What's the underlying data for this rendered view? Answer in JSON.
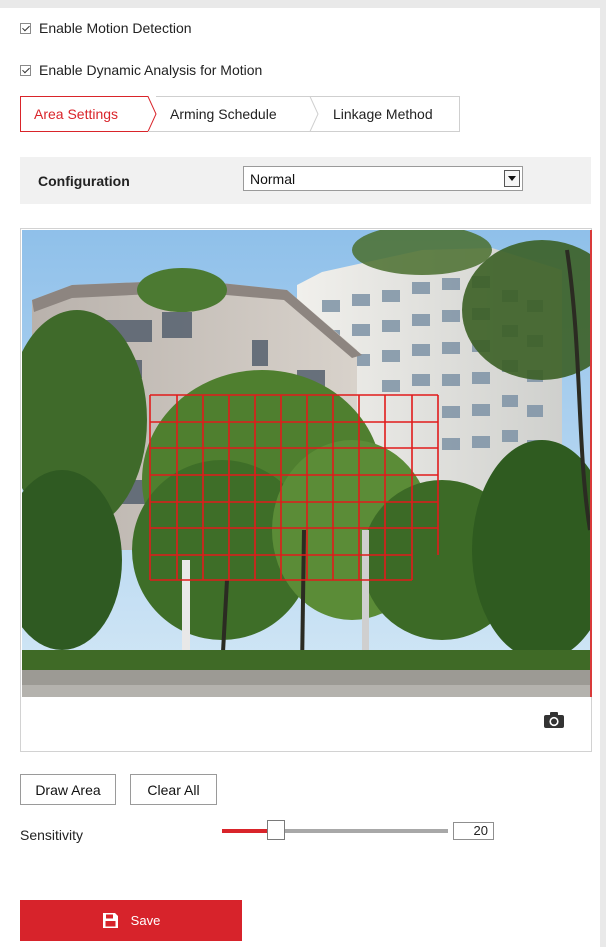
{
  "motion": {
    "enable_motion_detection": {
      "label": "Enable Motion Detection",
      "checked": true
    },
    "enable_dynamic_analysis": {
      "label": "Enable Dynamic Analysis for Motion",
      "checked": true
    }
  },
  "tabs": [
    {
      "label": "Area Settings",
      "active": true
    },
    {
      "label": "Arming Schedule",
      "active": false
    },
    {
      "label": "Linkage Method",
      "active": false
    }
  ],
  "config": {
    "label": "Configuration",
    "selected": "Normal"
  },
  "icons": {
    "camera": "camera-icon",
    "save": "floppy-disk-icon"
  },
  "buttons": {
    "draw_area": "Draw Area",
    "clear_all": "Clear All",
    "save": "Save"
  },
  "sensitivity": {
    "label": "Sensitivity",
    "value": "20",
    "fraction": 0.2
  },
  "colors": {
    "accent": "#d7232b",
    "grid": "#e11b1b"
  }
}
